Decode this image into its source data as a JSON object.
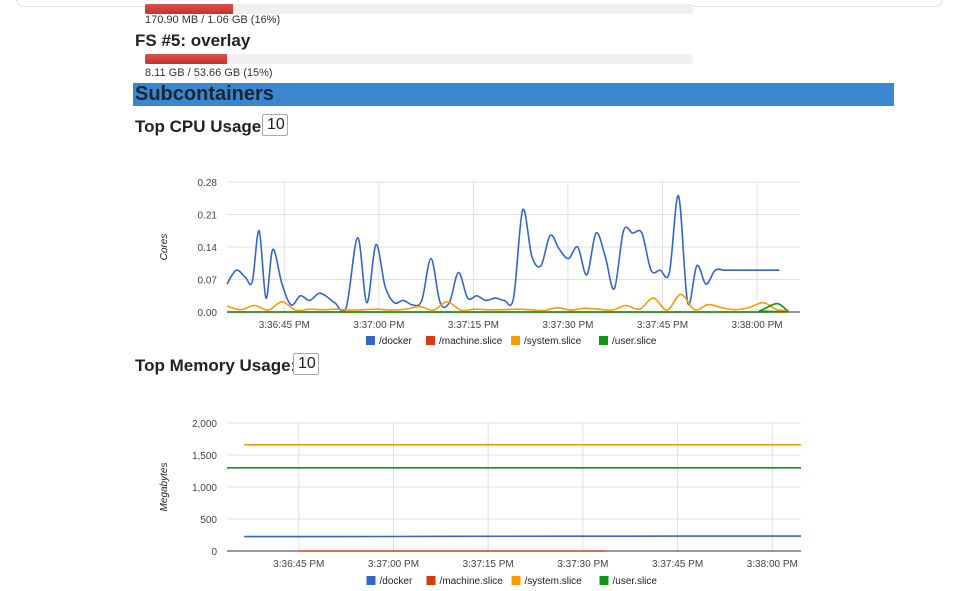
{
  "filesystems": [
    {
      "caption": "170.90 MB / 1.06 GB (16%)",
      "usage": 0.16
    },
    {
      "title": "FS #5: overlay",
      "caption": "8.11 GB / 53.66 GB (15%)",
      "usage": 0.15
    }
  ],
  "subcontainers": {
    "title": "Subcontainers",
    "header_color": "#3a87cf",
    "cpu": {
      "label": "Top CPU Usage:",
      "value": "10"
    },
    "memory": {
      "label": "Top Memory Usage:",
      "value": "10"
    }
  },
  "chart_data": [
    {
      "type": "line",
      "ylabel": "Cores",
      "xlabel": "",
      "ylim": [
        0,
        0.28
      ],
      "yticks": [
        "0.28",
        "0.21",
        "0.14",
        "0.07",
        "0.00"
      ],
      "ytick_values": [
        0.28,
        0.21,
        0.14,
        0.07,
        0
      ],
      "xlim": [
        0,
        100
      ],
      "xticks": [
        "3:36:45 PM",
        "3:37:00 PM",
        "3:37:15 PM",
        "3:37:30 PM",
        "3:37:45 PM",
        "3:38:00 PM"
      ],
      "xtick_values": [
        10,
        26.5,
        43,
        59.5,
        76,
        92.5
      ],
      "grid": true,
      "legend": "bottom",
      "series": [
        {
          "name": "/docker",
          "color": "#3366cc",
          "x": [
            0,
            1.6,
            3.2,
            4.4,
            5.6,
            6.8,
            8.0,
            9.6,
            11.2,
            12.8,
            14.4,
            16.0,
            17.2,
            18.8,
            20.8,
            22.8,
            24.4,
            26.0,
            27.6,
            29.2,
            30.8,
            32.4,
            34.0,
            35.6,
            37.2,
            38.8,
            40.4,
            42.0,
            43.6,
            45.2,
            46.8,
            48.4,
            50.0,
            51.6,
            53.2,
            54.8,
            56.4,
            58.0,
            59.6,
            61.2,
            62.8,
            64.4,
            66.0,
            67.6,
            69.2,
            70.8,
            72.4,
            74.0,
            75.6,
            77.2,
            78.8,
            80.4,
            82.0,
            83.6,
            85.2,
            86.8,
            88.4,
            90.0,
            91.6,
            93.2,
            94.8,
            96.4
          ],
          "values": [
            0.06,
            0.09,
            0.075,
            0.065,
            0.175,
            0.03,
            0.135,
            0.06,
            0.015,
            0.035,
            0.025,
            0.04,
            0.035,
            0.02,
            0.01,
            0.16,
            0.02,
            0.145,
            0.055,
            0.02,
            0.025,
            0.015,
            0.025,
            0.115,
            0.02,
            0.02,
            0.085,
            0.03,
            0.035,
            0.025,
            0.03,
            0.025,
            0.03,
            0.22,
            0.12,
            0.1,
            0.165,
            0.135,
            0.115,
            0.14,
            0.08,
            0.17,
            0.12,
            0.05,
            0.175,
            0.17,
            0.17,
            0.09,
            0.09,
            0.085,
            0.25,
            0.02,
            0.1,
            0.06,
            0.09,
            0.09,
            0.09,
            0.09,
            0.09,
            0.09,
            0.09,
            0.09
          ]
        },
        {
          "name": "/machine.slice",
          "color": "#dc3912",
          "x": [
            0,
            98
          ],
          "values": [
            0,
            0
          ]
        },
        {
          "name": "/system.slice",
          "color": "#ff9900",
          "x": [
            0,
            2.4,
            4.8,
            7.2,
            9.6,
            12.0,
            14.4,
            16.8,
            19.2,
            21.6,
            24.0,
            26.4,
            28.8,
            31.2,
            33.6,
            36.0,
            38.4,
            40.8,
            43.2,
            45.6,
            48.0,
            50.4,
            52.8,
            55.2,
            57.6,
            60.0,
            62.4,
            64.8,
            67.2,
            69.6,
            72.0,
            74.4,
            76.8,
            79.2,
            81.6,
            84.0,
            86.4,
            88.8,
            91.2,
            93.6,
            96.0,
            98.0
          ],
          "values": [
            0.013,
            0.005,
            0.014,
            0.004,
            0.022,
            0.004,
            0.006,
            0.005,
            0.006,
            0.004,
            0.005,
            0.006,
            0.004,
            0.006,
            0.012,
            0.004,
            0.022,
            0.004,
            0.006,
            0.005,
            0.005,
            0.006,
            0.005,
            0.003,
            0.009,
            0.004,
            0.008,
            0.006,
            0.004,
            0.014,
            0.006,
            0.03,
            0.004,
            0.038,
            0.005,
            0.016,
            0.009,
            0.005,
            0.01,
            0.02,
            0.005,
            0.004
          ]
        },
        {
          "name": "/user.slice",
          "color": "#109618",
          "x": [
            0,
            90,
            93,
            96,
            98
          ],
          "values": [
            0.0,
            0.0,
            0.003,
            0.018,
            0.0
          ]
        }
      ]
    },
    {
      "type": "line",
      "ylabel": "Megabytes",
      "xlabel": "",
      "ylim": [
        0,
        2000
      ],
      "yticks": [
        "2,000",
        "1,500",
        "1,000",
        "500",
        "0"
      ],
      "ytick_values": [
        2000,
        1500,
        1000,
        500,
        0
      ],
      "xlim": [
        0,
        100
      ],
      "xticks": [
        "3:36:45 PM",
        "3:37:00 PM",
        "3:37:15 PM",
        "3:37:30 PM",
        "3:37:45 PM",
        "3:38:00 PM"
      ],
      "xtick_values": [
        12.5,
        29,
        45.5,
        62,
        78.5,
        95
      ],
      "grid": true,
      "legend": "bottom",
      "series": [
        {
          "name": "/docker",
          "color": "#3366cc",
          "x": [
            3,
            20,
            40,
            60,
            80,
            100
          ],
          "values": [
            225,
            225,
            230,
            232,
            233,
            233
          ]
        },
        {
          "name": "/machine.slice",
          "color": "#dc3912",
          "x": [
            12.5,
            66
          ],
          "values": [
            0,
            0
          ]
        },
        {
          "name": "/system.slice",
          "color": "#ff9900",
          "x": [
            3,
            100
          ],
          "values": [
            1660,
            1660
          ]
        },
        {
          "name": "/user.slice",
          "color": "#109618",
          "x": [
            0,
            100
          ],
          "values": [
            1300,
            1300
          ]
        }
      ]
    }
  ]
}
